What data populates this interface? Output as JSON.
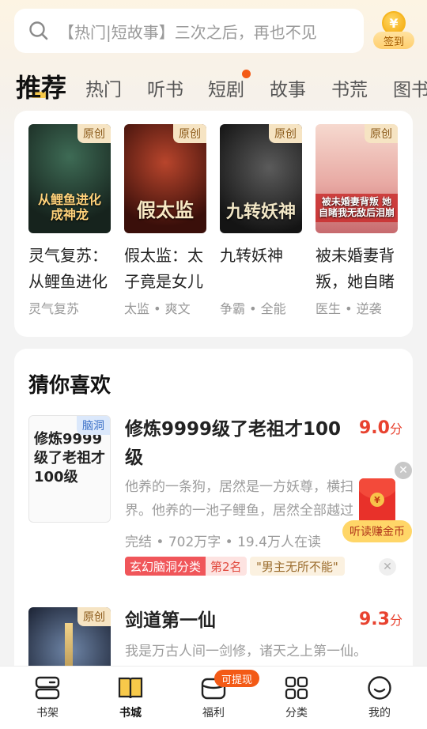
{
  "search": {
    "placeholder": "【热门|短故事】三次之后，再也不见"
  },
  "checkin": {
    "coin_symbol": "¥",
    "label": "签到"
  },
  "tabs": [
    {
      "label": "推荐",
      "active": true
    },
    {
      "label": "热门",
      "active": false
    },
    {
      "label": "听书",
      "active": false
    },
    {
      "label": "短剧",
      "active": false,
      "dot": true
    },
    {
      "label": "故事",
      "active": false
    },
    {
      "label": "书荒",
      "active": false
    },
    {
      "label": "图书",
      "active": false
    }
  ],
  "recommended": [
    {
      "cover_text": "从鲤鱼进化成神龙",
      "badge": "原创",
      "title": "灵气复苏：从鲤鱼进化",
      "tags": "灵气复苏"
    },
    {
      "cover_text": "假太监",
      "badge": "原创",
      "title": "假太监：太子竟是女儿",
      "tags": "太监 • 爽文"
    },
    {
      "cover_text": "九转妖神",
      "badge": "原创",
      "title": "九转妖神",
      "tags": "争霸 • 全能"
    },
    {
      "cover_text": "被未婚妻背叛 她自睹我无敌后泪崩",
      "badge": "原创",
      "title": "被未婚妻背叛，她自睹",
      "tags": "医生 • 逆袭"
    }
  ],
  "guess": {
    "section_title": "猜你喜欢",
    "books": [
      {
        "cover_text": "修炼9999级了老祖才100级",
        "badge": "脑洞",
        "title_line1": "修炼9999级了老祖才100",
        "title_line2": "级",
        "score": "9.0",
        "score_unit": "分",
        "desc_line1": "他养的一条狗，居然是一方妖尊，横扫",
        "desc_line2": "界。他养的一池子鲤鱼，居然全部越过",
        "meta": "完结 • 702万字 • 19.4万人在读",
        "rank_category": "玄幻脑洞分类",
        "rank_position": "第2名",
        "keyword": "\"男主无所不能\"",
        "dismiss": "✕"
      },
      {
        "cover_text": "",
        "badge": "原创",
        "title_line1": "剑道第一仙",
        "score": "9.3",
        "score_unit": "分",
        "desc_line1": "我是万古人间一剑修，诸天之上第一仙。"
      }
    ]
  },
  "floating": {
    "close": "✕",
    "coin_symbol": "¥",
    "label": "听读赚金币"
  },
  "bottom_nav": [
    {
      "label": "书架",
      "icon": "bookshelf-icon",
      "active": false
    },
    {
      "label": "书城",
      "icon": "bookstore-icon",
      "active": true
    },
    {
      "label": "福利",
      "icon": "wallet-icon",
      "active": false,
      "badge": "可提现"
    },
    {
      "label": "分类",
      "icon": "category-grid-icon",
      "active": false
    },
    {
      "label": "我的",
      "icon": "profile-face-icon",
      "active": false
    }
  ],
  "colors": {
    "accent_red": "#e8422f",
    "accent_orange": "#f35a16",
    "tab_highlight": "#f7c94a",
    "badge_bg": "#f6e4c3"
  }
}
